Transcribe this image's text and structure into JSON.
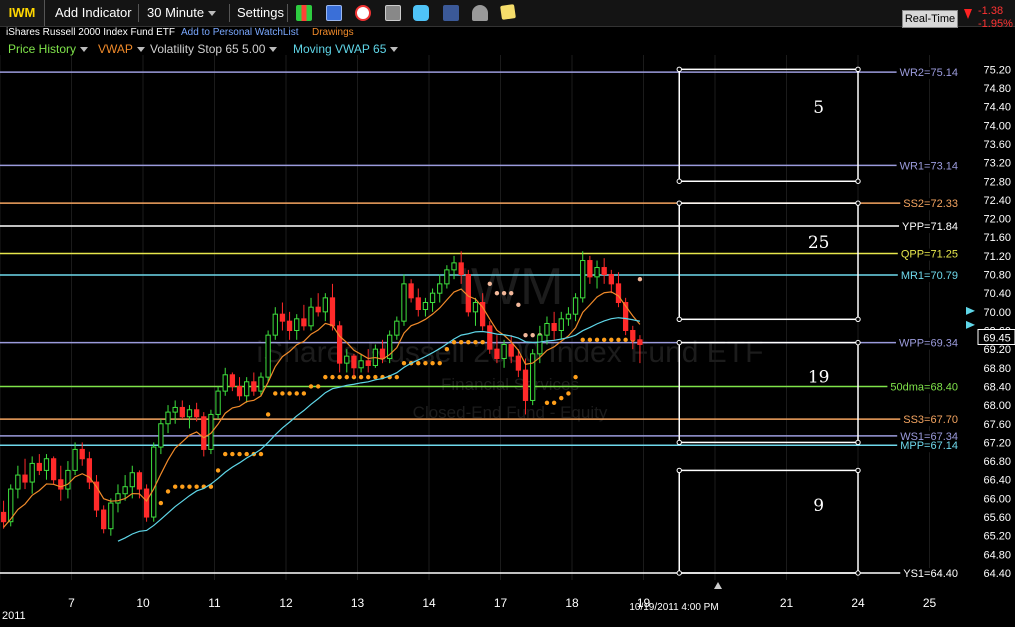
{
  "toolbar": {
    "symbol": "IWM",
    "add_indicator": "Add Indicator",
    "interval": "30 Minute",
    "settings": "Settings",
    "realtime": "Real-Time",
    "change": "-1.38",
    "change_pct": "-1.95%",
    "change_color": "#ff3333"
  },
  "subbar": {
    "fund_name": "iShares Russell 2000 Index Fund ETF",
    "watchlist_link": "Add to Personal WatchList",
    "drawings": "Drawings"
  },
  "legend": [
    {
      "label": "Price History",
      "color": "#7fe34a"
    },
    {
      "label": "VWAP",
      "color": "#f08a2a"
    },
    {
      "label": "Volatility Stop 65 5.00",
      "color": "#d0d0d0"
    },
    {
      "label": "Moving VWAP 65",
      "color": "#5fd6e8"
    }
  ],
  "watermark": {
    "symbol": "IWM",
    "name": "iShares Russell 2000 Index Fund ETF",
    "sector": "Financial Services",
    "category": "Closed-End Fund - Equity"
  },
  "chart_data": {
    "type": "candlestick",
    "y_axis_labels": [
      "75.20",
      "74.80",
      "74.40",
      "74.00",
      "73.60",
      "73.20",
      "72.80",
      "72.40",
      "72.00",
      "71.60",
      "71.20",
      "70.80",
      "70.40",
      "70.00",
      "69.60",
      "69.20",
      "68.80",
      "68.40",
      "68.00",
      "67.60",
      "67.20",
      "66.80",
      "66.40",
      "66.00",
      "65.60",
      "65.20",
      "64.80",
      "64.40"
    ],
    "ylim": [
      64.25,
      75.4
    ],
    "x_ticks": [
      {
        "label": "7",
        "trading": true
      },
      {
        "label": "10",
        "trading": true
      },
      {
        "label": "11",
        "trading": true
      },
      {
        "label": "12",
        "trading": true
      },
      {
        "label": "13",
        "trading": true
      },
      {
        "label": "14",
        "trading": true
      },
      {
        "label": "17",
        "trading": true
      },
      {
        "label": "18",
        "trading": true
      },
      {
        "label": "19",
        "trading": true
      },
      {
        "label": "21",
        "trading": false
      },
      {
        "label": "24",
        "trading": false
      },
      {
        "label": "25",
        "trading": false
      }
    ],
    "year_label": "2011",
    "current_time": "10/19/2011 4:00 PM",
    "last_price": "69.45",
    "hlines": [
      {
        "label": "WR2=75.14",
        "value": 75.14,
        "color": "#9b9bdc"
      },
      {
        "label": "WR1=73.14",
        "value": 73.14,
        "color": "#9b9bdc"
      },
      {
        "label": "SS2=72.33",
        "value": 72.33,
        "color": "#f4a460"
      },
      {
        "label": "YPP=71.84",
        "value": 71.84,
        "color": "#ffffff"
      },
      {
        "label": "QPP=71.25",
        "value": 71.25,
        "color": "#e6e64c"
      },
      {
        "label": "MR1=70.79",
        "value": 70.79,
        "color": "#6fd9ec"
      },
      {
        "label": "WPP=69.34",
        "value": 69.34,
        "color": "#9b9bdc"
      },
      {
        "label": "50dma=68.40",
        "value": 68.4,
        "color": "#7fe34a"
      },
      {
        "label": "SS3=67.70",
        "value": 67.7,
        "color": "#f4a460"
      },
      {
        "label": "WS1=67.34",
        "value": 67.34,
        "color": "#9b9bdc"
      },
      {
        "label": "MPP=67.14",
        "value": 67.14,
        "color": "#6fd9ec"
      },
      {
        "label": "YS1=64.40",
        "value": 64.4,
        "color": "#ffffff"
      }
    ],
    "boxes": [
      {
        "label": "5",
        "top": 75.2,
        "bottom": 72.8
      },
      {
        "label": "25",
        "top": 72.33,
        "bottom": 69.84
      },
      {
        "label": "19",
        "top": 69.34,
        "bottom": 67.2
      },
      {
        "label": "9",
        "top": 66.6,
        "bottom": 64.4
      }
    ],
    "candles": [
      [
        65.7,
        65.95,
        65.35,
        65.5
      ],
      [
        65.5,
        66.3,
        65.4,
        66.2
      ],
      [
        66.2,
        66.7,
        66.0,
        66.5
      ],
      [
        66.5,
        66.85,
        66.2,
        66.35
      ],
      [
        66.35,
        66.9,
        66.1,
        66.75
      ],
      [
        66.75,
        66.95,
        66.5,
        66.6
      ],
      [
        66.6,
        66.95,
        66.4,
        66.85
      ],
      [
        66.85,
        66.9,
        66.3,
        66.4
      ],
      [
        66.4,
        66.7,
        65.95,
        66.2
      ],
      [
        66.2,
        66.8,
        66.0,
        66.6
      ],
      [
        66.6,
        67.2,
        66.5,
        67.05
      ],
      [
        67.05,
        67.2,
        66.7,
        66.85
      ],
      [
        66.85,
        67.0,
        66.2,
        66.35
      ],
      [
        66.35,
        66.5,
        65.6,
        65.75
      ],
      [
        65.75,
        65.85,
        65.25,
        65.35
      ],
      [
        65.35,
        66.0,
        65.2,
        65.9
      ],
      [
        65.9,
        66.3,
        65.7,
        66.1
      ],
      [
        66.1,
        66.5,
        65.95,
        66.25
      ],
      [
        66.25,
        66.7,
        66.0,
        66.55
      ],
      [
        66.55,
        66.6,
        66.0,
        66.2
      ],
      [
        66.2,
        66.3,
        65.5,
        65.6
      ],
      [
        65.6,
        67.2,
        65.5,
        67.1
      ],
      [
        67.1,
        67.7,
        66.95,
        67.6
      ],
      [
        67.6,
        68.0,
        67.4,
        67.85
      ],
      [
        67.85,
        68.1,
        67.6,
        67.95
      ],
      [
        67.95,
        68.1,
        67.7,
        67.75
      ],
      [
        67.75,
        68.0,
        67.5,
        67.9
      ],
      [
        67.9,
        68.05,
        67.65,
        67.75
      ],
      [
        67.75,
        67.85,
        66.9,
        67.05
      ],
      [
        67.05,
        67.9,
        66.95,
        67.8
      ],
      [
        67.8,
        68.4,
        67.7,
        68.3
      ],
      [
        68.3,
        68.8,
        68.2,
        68.65
      ],
      [
        68.65,
        68.7,
        68.3,
        68.4
      ],
      [
        68.4,
        68.6,
        68.1,
        68.2
      ],
      [
        68.2,
        68.6,
        68.05,
        68.5
      ],
      [
        68.5,
        68.7,
        68.2,
        68.3
      ],
      [
        68.3,
        68.7,
        68.2,
        68.6
      ],
      [
        68.6,
        69.6,
        68.5,
        69.5
      ],
      [
        69.5,
        70.1,
        69.4,
        69.95
      ],
      [
        69.95,
        70.2,
        69.6,
        69.8
      ],
      [
        69.8,
        70.0,
        69.4,
        69.6
      ],
      [
        69.6,
        69.95,
        69.4,
        69.85
      ],
      [
        69.85,
        70.15,
        69.6,
        69.7
      ],
      [
        69.7,
        70.3,
        69.6,
        70.1
      ],
      [
        70.1,
        70.4,
        69.9,
        70.0
      ],
      [
        70.0,
        70.4,
        69.8,
        70.3
      ],
      [
        70.3,
        70.6,
        69.6,
        69.7
      ],
      [
        69.7,
        69.8,
        68.7,
        68.9
      ],
      [
        68.9,
        69.2,
        68.7,
        69.05
      ],
      [
        69.05,
        69.1,
        68.6,
        68.8
      ],
      [
        68.8,
        69.1,
        68.7,
        68.95
      ],
      [
        68.95,
        69.2,
        68.7,
        68.85
      ],
      [
        68.85,
        69.3,
        68.8,
        69.2
      ],
      [
        69.2,
        69.4,
        68.9,
        69.0
      ],
      [
        69.0,
        69.6,
        68.9,
        69.5
      ],
      [
        69.5,
        69.9,
        69.4,
        69.8
      ],
      [
        69.8,
        70.8,
        69.7,
        70.6
      ],
      [
        70.6,
        70.7,
        70.2,
        70.3
      ],
      [
        70.3,
        70.5,
        69.9,
        70.05
      ],
      [
        70.05,
        70.3,
        69.9,
        70.2
      ],
      [
        70.2,
        70.5,
        70.0,
        70.4
      ],
      [
        70.4,
        70.8,
        70.2,
        70.6
      ],
      [
        70.6,
        71.0,
        70.5,
        70.9
      ],
      [
        70.9,
        71.2,
        70.7,
        71.05
      ],
      [
        71.05,
        71.3,
        70.6,
        70.8
      ],
      [
        70.8,
        70.9,
        69.9,
        70.0
      ],
      [
        70.0,
        70.3,
        69.7,
        70.2
      ],
      [
        70.2,
        70.4,
        69.6,
        69.7
      ],
      [
        69.7,
        69.8,
        69.1,
        69.2
      ],
      [
        69.2,
        69.5,
        68.9,
        69.0
      ],
      [
        69.0,
        69.4,
        68.8,
        69.3
      ],
      [
        69.3,
        69.5,
        68.9,
        69.05
      ],
      [
        69.05,
        69.2,
        68.6,
        68.75
      ],
      [
        68.75,
        69.0,
        67.8,
        68.1
      ],
      [
        68.1,
        69.2,
        68.0,
        69.1
      ],
      [
        69.1,
        69.7,
        68.9,
        69.5
      ],
      [
        69.5,
        69.9,
        69.3,
        69.75
      ],
      [
        69.75,
        70.0,
        69.4,
        69.6
      ],
      [
        69.6,
        70.0,
        69.4,
        69.85
      ],
      [
        69.85,
        70.1,
        69.7,
        69.95
      ],
      [
        69.95,
        70.4,
        69.8,
        70.3
      ],
      [
        70.3,
        71.3,
        70.2,
        71.1
      ],
      [
        71.1,
        71.2,
        70.6,
        70.75
      ],
      [
        70.75,
        71.1,
        70.5,
        70.95
      ],
      [
        70.95,
        71.15,
        70.6,
        70.8
      ],
      [
        70.8,
        70.9,
        70.4,
        70.6
      ],
      [
        70.6,
        70.85,
        70.1,
        70.2
      ],
      [
        70.2,
        70.3,
        69.5,
        69.6
      ],
      [
        69.6,
        69.7,
        69.2,
        69.4
      ],
      [
        69.4,
        69.5,
        68.9,
        69.3
      ]
    ],
    "vwap_series": {
      "name": "VWAP"
    },
    "mvwap_series": {
      "name": "Moving VWAP 65"
    },
    "vstop_series": {
      "name": "Volatility Stop 65 5.00"
    }
  }
}
